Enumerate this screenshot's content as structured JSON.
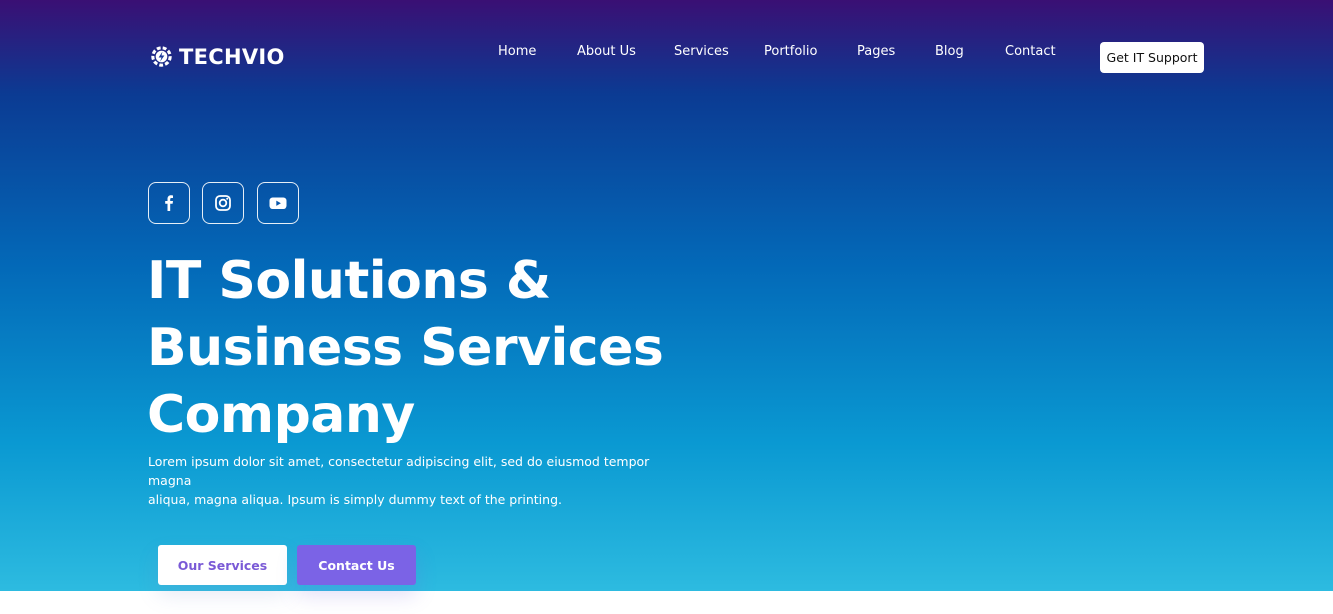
{
  "brand": {
    "name": "TECHVIO",
    "logo_icon": "gear-bolt-icon"
  },
  "nav": {
    "items": [
      {
        "label": "Home"
      },
      {
        "label": "About Us"
      },
      {
        "label": "Services"
      },
      {
        "label": "Portfolio"
      },
      {
        "label": "Pages"
      },
      {
        "label": "Blog"
      },
      {
        "label": "Contact"
      }
    ],
    "cta_label": "Get IT Support"
  },
  "social": [
    {
      "icon": "facebook-icon"
    },
    {
      "icon": "instagram-icon"
    },
    {
      "icon": "youtube-icon"
    }
  ],
  "hero": {
    "title_line1": "IT Solutions &",
    "title_line2": "Business Services",
    "title_line3": "Company",
    "description_line1": "Lorem ipsum dolor sit amet, consectetur adipiscing elit, sed do eiusmod tempor magna",
    "description_line2": "aliqua, magna aliqua. Ipsum is simply dummy text of the printing.",
    "primary_button": "Our Services",
    "secondary_button": "Contact Us"
  },
  "colors": {
    "gradient_top": "#3a0f74",
    "gradient_bottom": "#2dbbe0",
    "button_purple": "#7b63e6",
    "button_text_purple": "#7a5ad6"
  }
}
